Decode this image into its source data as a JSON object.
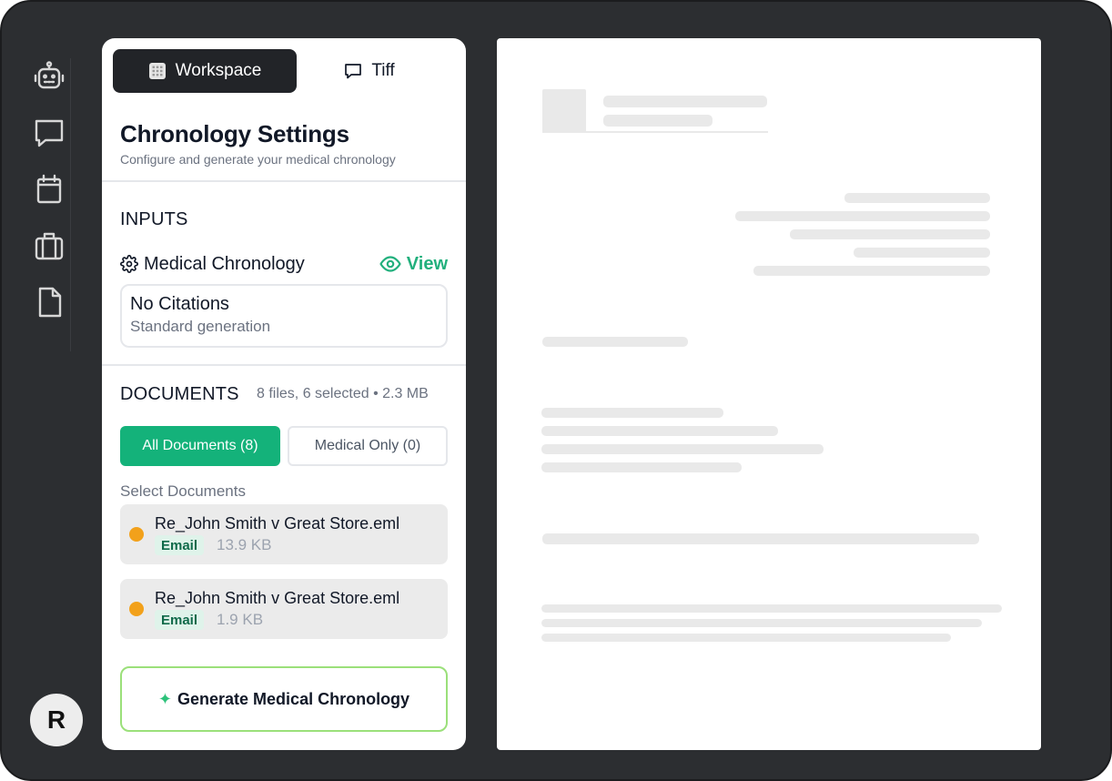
{
  "rail": {
    "items": [
      {
        "icon": "robot-icon"
      },
      {
        "icon": "chat-icon"
      },
      {
        "icon": "calendar-icon"
      },
      {
        "icon": "briefcase-icon"
      },
      {
        "icon": "file-icon"
      }
    ],
    "avatar_initial": "R"
  },
  "tabs": {
    "workspace": "Workspace",
    "tiff": "Tiff"
  },
  "settings": {
    "title": "Chronology Settings",
    "subtitle": "Configure and generate your medical chronology",
    "inputs_label": "INPUTS",
    "chronology_label": "Medical Chronology",
    "view_label": "View",
    "option": {
      "title": "No Citations",
      "subtitle": "Standard generation"
    }
  },
  "documents": {
    "label": "DOCUMENTS",
    "meta": "8 files, 6 selected • 2.3 MB",
    "filter_all": "All Documents (8)",
    "filter_medical": "Medical Only (0)",
    "select_label": "Select Documents",
    "items": [
      {
        "name": "Re_John Smith v Great Store.eml",
        "type": "Email",
        "size": "13.9 KB"
      },
      {
        "name": "Re_John Smith v Great Store.eml",
        "type": "Email",
        "size": "1.9 KB"
      }
    ]
  },
  "generate": {
    "label": "Generate Medical Chronology"
  },
  "colors": {
    "accent_green": "#14b27a",
    "view_green": "#22b07d",
    "status_orange": "#f2a11b",
    "dark": "#222428"
  }
}
